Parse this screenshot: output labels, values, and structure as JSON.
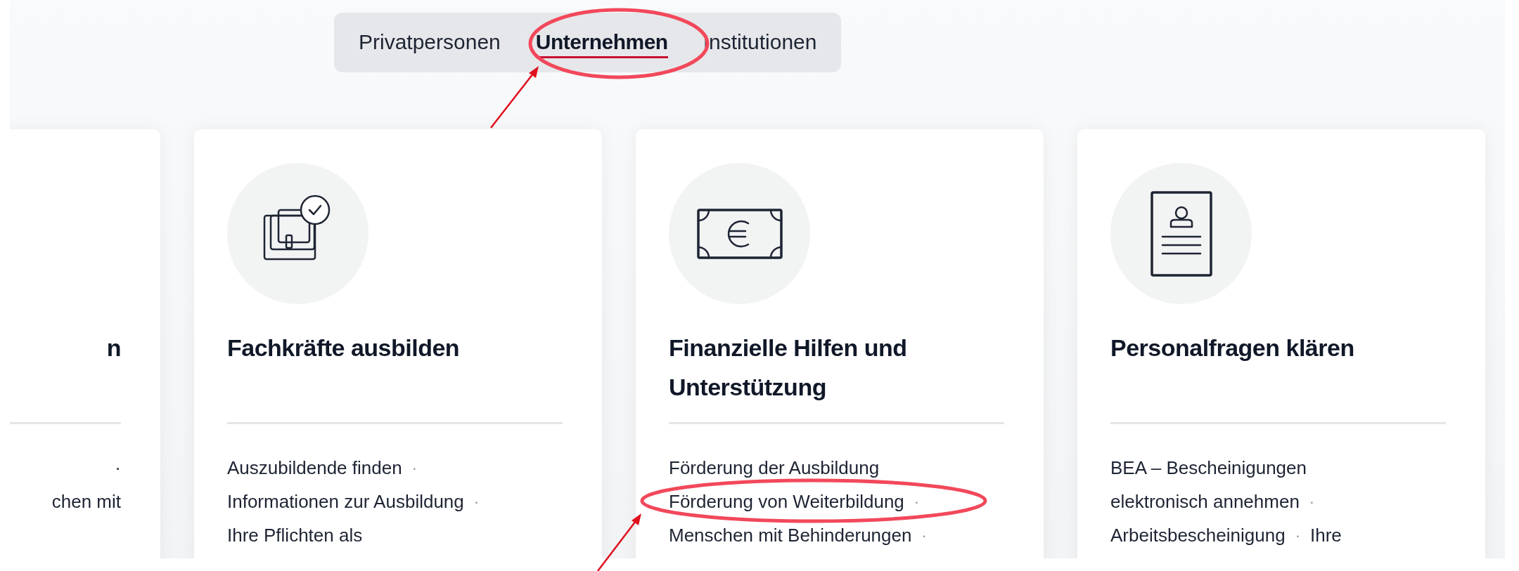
{
  "tabs": [
    {
      "label": "Privatpersonen",
      "selected": false
    },
    {
      "label": "Unternehmen",
      "selected": true
    },
    {
      "label": "Institutionen",
      "selected": false
    }
  ],
  "cards": [
    {
      "kind": "partial",
      "title": "n",
      "lines": [
        [
          {
            "text": "·"
          }
        ],
        [
          {
            "text": "chen mit"
          }
        ]
      ]
    },
    {
      "kind": "briefcase",
      "title": "Fachkräfte ausbilden",
      "lines": [
        [
          {
            "text": "Auszubildende finden",
            "separator": "·"
          }
        ],
        [
          {
            "text": "Informationen zur Ausbildung",
            "separator": "·"
          }
        ],
        [
          {
            "text": "Ihre Pflichten als"
          }
        ]
      ]
    },
    {
      "kind": "money",
      "title": "Finanzielle Hilfen und Unterstützung",
      "lines": [
        [
          {
            "text": "Förderung der Ausbildung"
          }
        ],
        [
          {
            "text": "Förderung von Weiterbildung",
            "separator": "·"
          }
        ],
        [
          {
            "text": "Menschen mit Behinderungen",
            "separator": "·"
          }
        ]
      ]
    },
    {
      "kind": "document",
      "title": "Personalfragen klären",
      "lines": [
        [
          {
            "text": "BEA – Bescheinigungen"
          }
        ],
        [
          {
            "text": "elektronisch annehmen",
            "separator": "·"
          }
        ],
        [
          {
            "text": "Arbeitsbescheinigung",
            "separator": "·"
          },
          {
            "text": "Ihre"
          }
        ]
      ]
    }
  ]
}
